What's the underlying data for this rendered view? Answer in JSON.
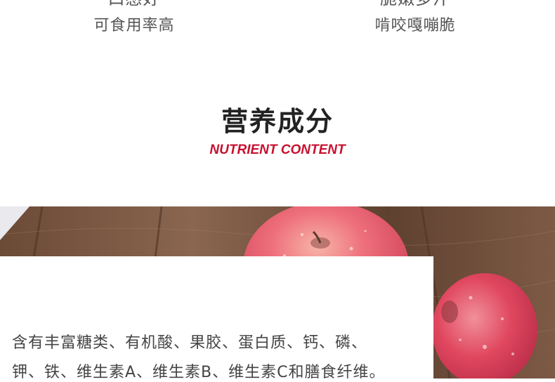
{
  "features": [
    {
      "cut_line": "口感好",
      "sub": "可食用率高"
    },
    {
      "cut_line": "脆嫩多汁",
      "sub": "啃咬嘎嘣脆"
    }
  ],
  "section": {
    "title": "营养成分",
    "subtitle": "NUTRIENT CONTENT"
  },
  "nutrition": {
    "line1": "含有丰富糖类、有机酸、果胶、蛋白质、钙、磷、",
    "line2": "钾、铁、维生素A、维生素B、维生素C和膳食纤维。"
  },
  "colors": {
    "accent": "#c8102e",
    "title": "#222222",
    "body_text": "#444444",
    "wood": "#7a5a44",
    "apple": "#e8566a"
  },
  "icons": [
    "apple-photo"
  ]
}
